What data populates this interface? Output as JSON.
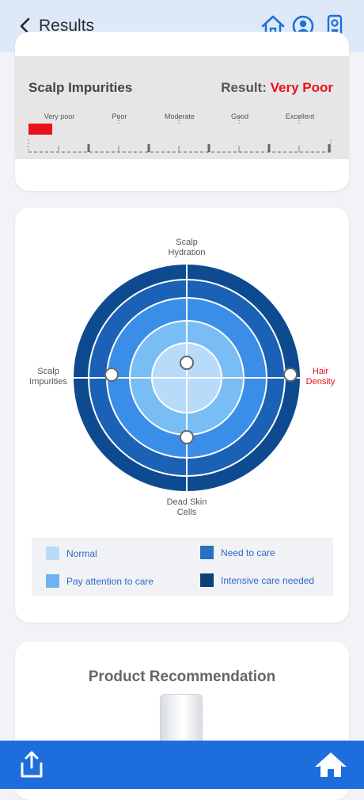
{
  "header": {
    "title": "Results"
  },
  "impurities": {
    "title": "Scalp Impurities",
    "result_label": "Result:",
    "result_value": "Very Poor",
    "scale_labels": [
      "Very poor",
      "Poor",
      "Moderate",
      "Good",
      "Excellent"
    ],
    "level": 1,
    "result_color": "#e8121b"
  },
  "radar": {
    "axes": {
      "top": [
        "Scalp",
        "Hydration"
      ],
      "left": [
        "Scalp",
        "Impurities"
      ],
      "right": [
        "Hair",
        "Density"
      ],
      "bottom": [
        "Dead Skin",
        "Cells"
      ]
    },
    "highlight_axis_color": "#e8121b",
    "ring_colors": [
      "#b8dbfa",
      "#79bdf5",
      "#3a8ee8",
      "#1b61b5",
      "#0e4a8f"
    ]
  },
  "legend": [
    {
      "label": "Normal",
      "color": "#b8dbfa"
    },
    {
      "label": "Need to care",
      "color": "#2a6fc0"
    },
    {
      "label": "Pay attention to care",
      "color": "#6fb2f2"
    },
    {
      "label": "Intensive care needed",
      "color": "#0e3f78"
    }
  ],
  "product": {
    "title": "Product Recommendation"
  }
}
